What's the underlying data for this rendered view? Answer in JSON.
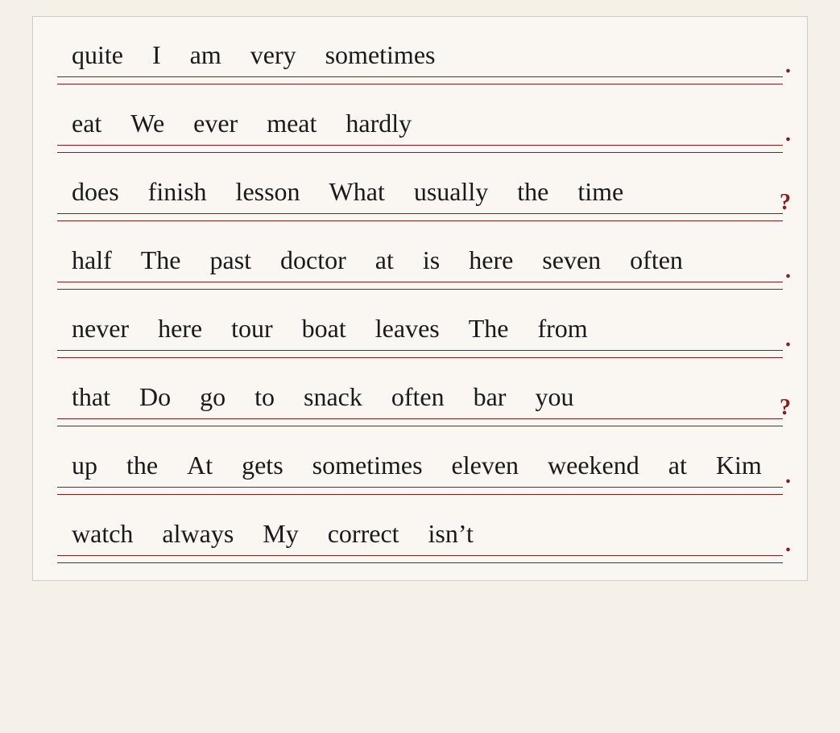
{
  "rows": [
    {
      "id": "row-1",
      "words": [
        "quite",
        "I",
        "am",
        "very",
        "sometimes"
      ],
      "punctuation": "."
    },
    {
      "id": "row-2",
      "words": [
        "eat",
        "We",
        "ever",
        "meat",
        "hardly"
      ],
      "punctuation": "."
    },
    {
      "id": "row-3",
      "words": [
        "does",
        "finish",
        "lesson",
        "What",
        "usually",
        "the",
        "time"
      ],
      "punctuation": "?"
    },
    {
      "id": "row-4",
      "words": [
        "half",
        "The",
        "past",
        "doctor",
        "at",
        "is",
        "here",
        "seven",
        "often"
      ],
      "punctuation": "."
    },
    {
      "id": "row-5",
      "words": [
        "never",
        "here",
        "tour",
        "boat",
        "leaves",
        "The",
        "from"
      ],
      "punctuation": "."
    },
    {
      "id": "row-6",
      "words": [
        "that",
        "Do",
        "go",
        "to",
        "snack",
        "often",
        "bar",
        "you"
      ],
      "punctuation": "?"
    },
    {
      "id": "row-7",
      "words": [
        "up",
        "the",
        "At",
        "gets",
        "sometimes",
        "eleven",
        "weekend",
        "at",
        "Kim"
      ],
      "punctuation": "."
    },
    {
      "id": "row-8",
      "words": [
        "watch",
        "always",
        "My",
        "correct",
        "isn’t"
      ],
      "punctuation": "."
    }
  ]
}
